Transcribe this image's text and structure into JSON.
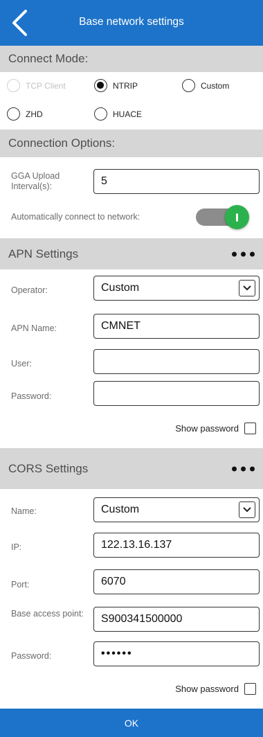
{
  "header": {
    "title": "Base network settings",
    "back_icon": "chevron-left-icon"
  },
  "connect_mode": {
    "heading": "Connect Mode:",
    "options": [
      {
        "label": "TCP Client",
        "selected": false,
        "disabled": true
      },
      {
        "label": "NTRIP",
        "selected": true,
        "disabled": false
      },
      {
        "label": "Custom",
        "selected": false,
        "disabled": false
      },
      {
        "label": "ZHD",
        "selected": false,
        "disabled": false
      },
      {
        "label": "HUACE",
        "selected": false,
        "disabled": false
      }
    ]
  },
  "connection_options": {
    "heading": "Connection Options:",
    "gga_label": "GGA Upload Interval(s):",
    "gga_value": "5",
    "auto_connect_label": "Automatically connect to network:",
    "auto_connect_on": true
  },
  "apn": {
    "heading": "APN Settings",
    "operator_label": "Operator:",
    "operator_value": "Custom",
    "apn_name_label": "APN Name:",
    "apn_name_value": "CMNET",
    "user_label": "User:",
    "user_value": "",
    "password_label": "Password:",
    "password_value": "",
    "show_password_label": "Show password",
    "show_password_checked": false
  },
  "cors": {
    "heading": "CORS Settings",
    "name_label": "Name:",
    "name_value": "Custom",
    "ip_label": "IP:",
    "ip_value": "122.13.16.137",
    "port_label": "Port:",
    "port_value": "6070",
    "mountpoint_label": "Base access point:",
    "mountpoint_value": "S900341500000",
    "password_label": "Password:",
    "password_value": "••••••",
    "show_password_label": "Show password",
    "show_password_checked": false
  },
  "footer": {
    "ok_label": "OK"
  },
  "colors": {
    "primary": "#1d73c9",
    "section_bg": "#d6d6d6",
    "toggle_on": "#2bb24c"
  }
}
